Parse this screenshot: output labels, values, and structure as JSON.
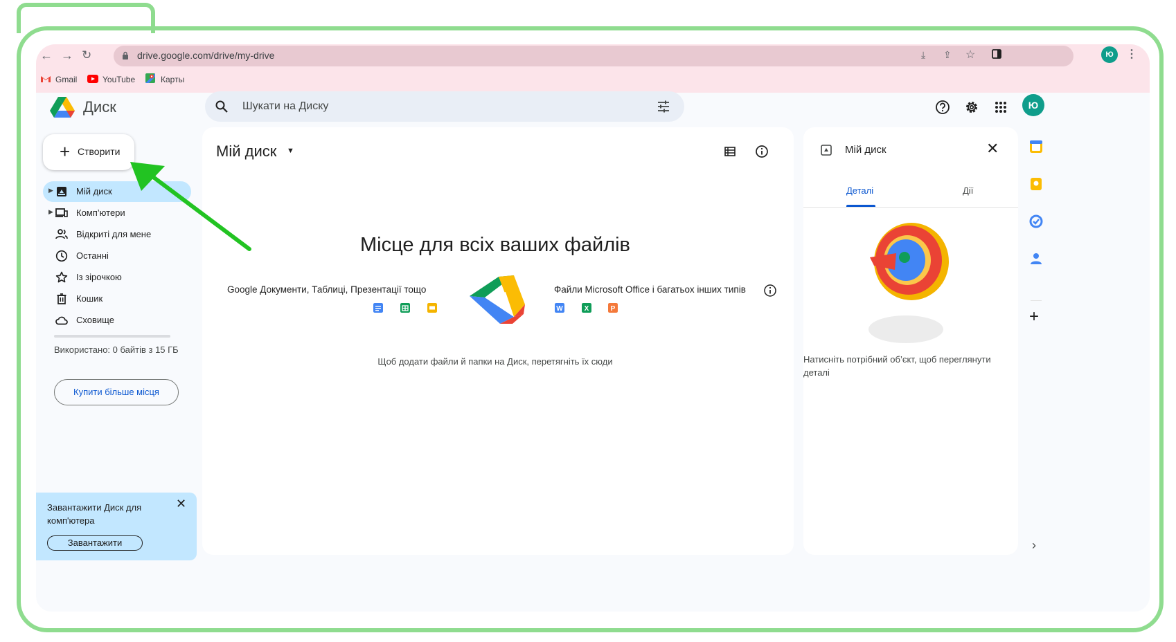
{
  "browser": {
    "url": "drive.google.com/drive/my-drive",
    "avatar_initial": "Ю",
    "bookmarks": [
      "Gmail",
      "YouTube",
      "Карты"
    ]
  },
  "header": {
    "app_name": "Диск",
    "search_placeholder": "Шукати на Диску",
    "avatar_initial": "Ю"
  },
  "sidebar": {
    "create_label": "Створити",
    "items": [
      {
        "label": "Мій диск",
        "icon": "my-drive-icon"
      },
      {
        "label": "Комп’ютери",
        "icon": "computers-icon"
      },
      {
        "label": "Відкриті для мене",
        "icon": "shared-icon"
      },
      {
        "label": "Останні",
        "icon": "clock-icon"
      },
      {
        "label": "Із зірочкою",
        "icon": "star-icon"
      },
      {
        "label": "Кошик",
        "icon": "trash-icon"
      },
      {
        "label": "Сховище",
        "icon": "cloud-icon"
      }
    ],
    "storage_text": "Використано: 0 байтів з 15 ГБ",
    "storage_used_fraction": 0,
    "buy_label": "Купити більше місця",
    "promo_text": "Завантажити Диск для комп'ютера",
    "promo_button": "Завантажити"
  },
  "main": {
    "title": "Мій диск",
    "empty_title": "Місце для всіх ваших файлів",
    "left_caption": "Google Документи, Таблиці, Презентації тощо",
    "right_caption": "Файли Microsoft Office і багатьох інших типів",
    "hint": "Щоб додати файли й папки на Диск, перетягніть їх сюди",
    "office_letters": [
      "W",
      "X",
      "P"
    ]
  },
  "details": {
    "title": "Мій диск",
    "tabs": [
      "Деталі",
      "Дії"
    ],
    "active_tab": "Деталі",
    "empty_text": "Натисніть потрібний об’єкт, щоб переглянути деталі"
  },
  "colors": {
    "frame": "#8fdc8f",
    "arrow": "#22c322",
    "accent": "#0b57d0",
    "active_nav": "#c2e7ff",
    "chrome": "#fce4ea"
  }
}
